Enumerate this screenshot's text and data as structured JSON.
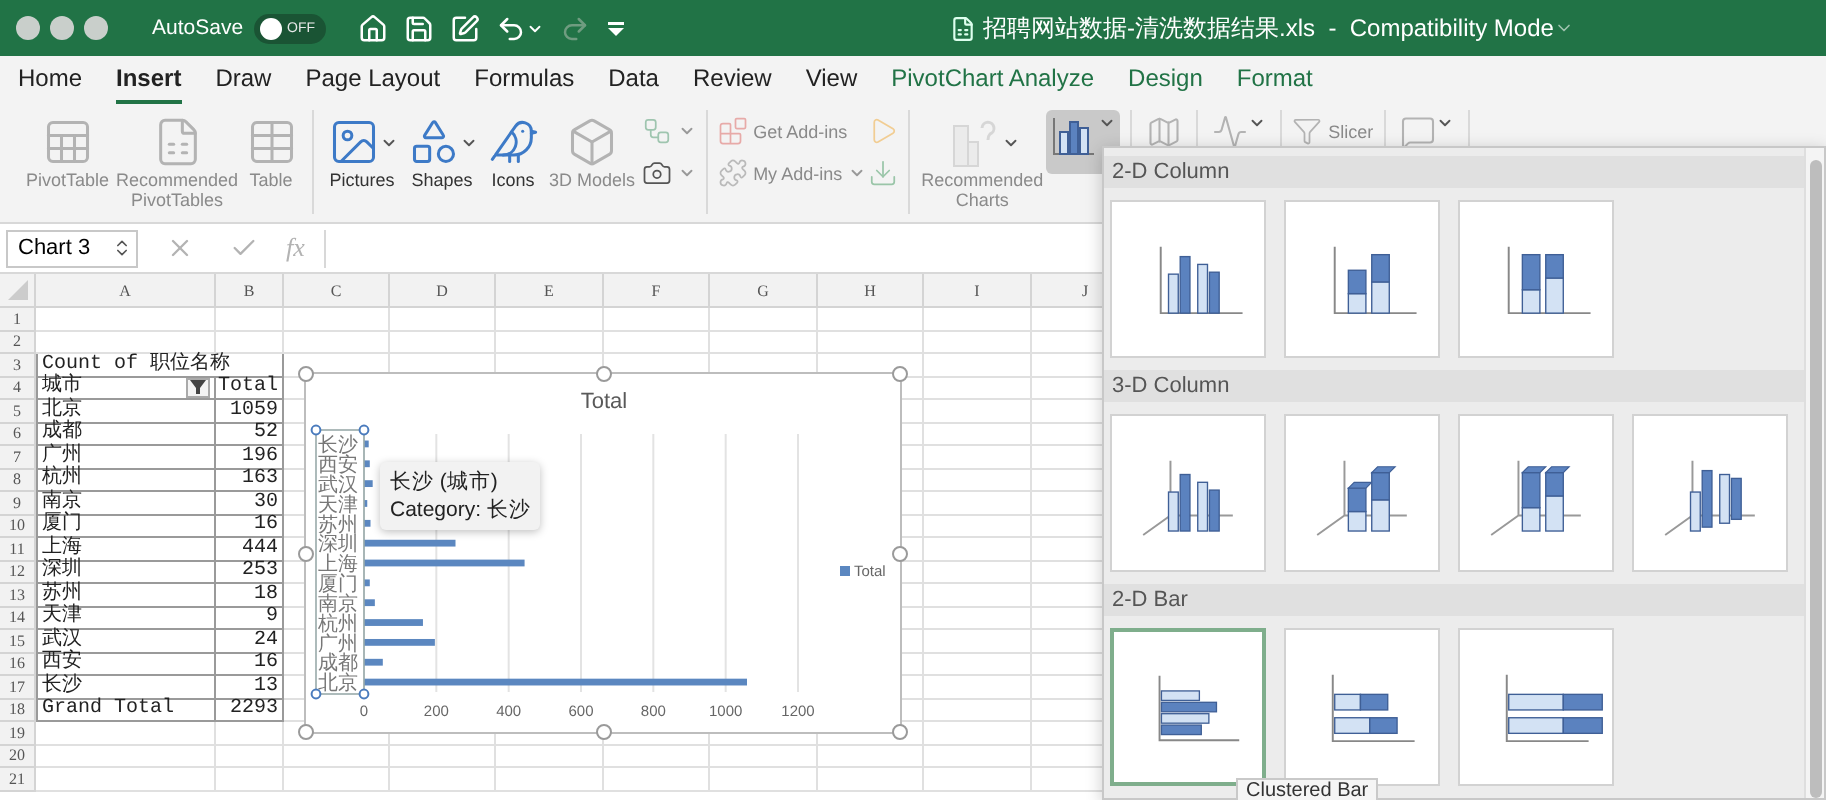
{
  "window": {
    "title": "招聘网站数据-清洗数据结果.xls  -  Compatibility Mode",
    "autosave": {
      "label": "AutoSave",
      "on": false,
      "state_text": "OFF"
    }
  },
  "quick_access": [
    {
      "disabled": false
    },
    {
      "disabled": false
    },
    {
      "disabled": false
    },
    {
      "disabled": false
    },
    {
      "disabled": true
    },
    {
      "disabled": false
    }
  ],
  "tabs": [
    {
      "label": "Home",
      "kind": "standard",
      "selected": false
    },
    {
      "label": "Insert",
      "kind": "standard",
      "selected": true
    },
    {
      "label": "Draw",
      "kind": "standard",
      "selected": false
    },
    {
      "label": "Page Layout",
      "kind": "standard",
      "selected": false
    },
    {
      "label": "Formulas",
      "kind": "standard",
      "selected": false
    },
    {
      "label": "Data",
      "kind": "standard",
      "selected": false
    },
    {
      "label": "Review",
      "kind": "standard",
      "selected": false
    },
    {
      "label": "View",
      "kind": "standard",
      "selected": false
    },
    {
      "label": "PivotChart Analyze",
      "kind": "contextual",
      "selected": false
    },
    {
      "label": "Design",
      "kind": "contextual",
      "selected": false
    },
    {
      "label": "Format",
      "kind": "contextual",
      "selected": false
    }
  ],
  "ribbon": {
    "groups": [
      {
        "items": [
          {
            "kind": "large",
            "label": "PivotTable",
            "disabled": true,
            "menu": false,
            "pressed": false
          },
          {
            "kind": "large",
            "label": "Recommended PivotTables",
            "disabled": true,
            "menu": false,
            "pressed": false
          },
          {
            "kind": "large",
            "label": "Table",
            "disabled": true,
            "menu": false,
            "pressed": false
          }
        ]
      },
      {
        "items": [
          {
            "kind": "large",
            "label": "Pictures",
            "disabled": false,
            "menu": true,
            "pressed": false
          },
          {
            "kind": "large",
            "label": "Shapes",
            "disabled": false,
            "menu": true,
            "pressed": false
          },
          {
            "kind": "large",
            "label": "Icons",
            "disabled": false,
            "menu": false,
            "pressed": false
          },
          {
            "kind": "large",
            "label": "3D Models",
            "disabled": true,
            "menu": false,
            "pressed": false
          },
          {
            "kind": "icon",
            "disabled": true,
            "menu": true,
            "pressed": false
          },
          {
            "kind": "icon",
            "disabled": false,
            "menu": true,
            "pressed": false
          }
        ]
      },
      {
        "items": [
          {
            "kind": "small",
            "label": "Get Add-ins",
            "disabled": true,
            "menu": false,
            "pressed": false
          },
          {
            "kind": "small",
            "label": "My Add-ins",
            "disabled": true,
            "menu": true,
            "pressed": false
          },
          {
            "kind": "icon",
            "disabled": true,
            "menu": false,
            "pressed": false
          },
          {
            "kind": "icon",
            "disabled": true,
            "menu": false,
            "pressed": false
          }
        ]
      },
      {
        "items": [
          {
            "kind": "large",
            "label": "Recommended Charts",
            "disabled": true,
            "menu": true,
            "pressed": false
          },
          {
            "kind": "large",
            "disabled": false,
            "menu": true,
            "pressed": true
          }
        ]
      },
      {
        "items": [
          {
            "kind": "large",
            "disabled": true,
            "menu": false,
            "pressed": false
          }
        ]
      },
      {
        "items": [
          {
            "kind": "large",
            "disabled": true,
            "menu": true,
            "pressed": false
          }
        ]
      },
      {
        "items": [
          {
            "kind": "small",
            "label": "Slicer",
            "disabled": true,
            "menu": false,
            "pressed": false
          }
        ]
      },
      {
        "items": [
          {
            "kind": "large",
            "disabled": true,
            "menu": true,
            "pressed": false
          }
        ]
      }
    ]
  },
  "formula_bar": {
    "name_box": "Chart 3",
    "function_label": "fx"
  },
  "sheet": {
    "columns": [
      "A",
      "B",
      "C",
      "D",
      "E",
      "F",
      "G",
      "H",
      "I",
      "J"
    ],
    "row_numbers": [
      "1",
      "2",
      "3",
      "4",
      "5",
      "6",
      "7",
      "8",
      "9",
      "10",
      "11",
      "12",
      "13",
      "14",
      "15",
      "16",
      "17",
      "18",
      "19",
      "20",
      "21"
    ],
    "pivot": {
      "header": "Count of 职位名称",
      "row_label": "城市",
      "value_label": "Total",
      "rows": [
        {
          "city": "北京",
          "count": "1059"
        },
        {
          "city": "成都",
          "count": "52"
        },
        {
          "city": "广州",
          "count": "196"
        },
        {
          "city": "杭州",
          "count": "163"
        },
        {
          "city": "南京",
          "count": "30"
        },
        {
          "city": "厦门",
          "count": "16"
        },
        {
          "city": "上海",
          "count": "444"
        },
        {
          "city": "深圳",
          "count": "253"
        },
        {
          "city": "苏州",
          "count": "18"
        },
        {
          "city": "天津",
          "count": "9"
        },
        {
          "city": "武汉",
          "count": "24"
        },
        {
          "city": "西安",
          "count": "16"
        },
        {
          "city": "长沙",
          "count": "13"
        }
      ],
      "total_label": "Grand Total",
      "total": "2293"
    },
    "chart": {
      "tooltip": {
        "title": "长沙 (城市)",
        "text": "Category: 长沙"
      },
      "chart_data": {
        "type": "bar",
        "orientation": "horizontal",
        "title": "Total",
        "categories": [
          "长沙",
          "西安",
          "武汉",
          "天津",
          "苏州",
          "深圳",
          "上海",
          "厦门",
          "南京",
          "杭州",
          "广州",
          "成都",
          "北京"
        ],
        "series": [
          {
            "name": "Total",
            "color": "#5b87c0",
            "values": [
              13,
              16,
              24,
              9,
              18,
              253,
              444,
              16,
              30,
              163,
              196,
              52,
              1059
            ]
          }
        ],
        "xlim": [
          0,
          1200
        ],
        "xticks": [
          0,
          200,
          400,
          600,
          800,
          1000,
          1200
        ],
        "grid": true
      }
    }
  },
  "chart_gallery": {
    "sections": [
      {
        "title": "2-D Column",
        "options": [
          {
            "kind": "clustered-column",
            "selected": false
          },
          {
            "kind": "stacked-column",
            "selected": false
          },
          {
            "kind": "full-stacked-column",
            "selected": false
          }
        ]
      },
      {
        "title": "3-D Column",
        "options": [
          {
            "kind": "clustered-column-3d",
            "selected": false
          },
          {
            "kind": "stacked-column-3d",
            "selected": false
          },
          {
            "kind": "full-stacked-column-3d",
            "selected": false
          },
          {
            "kind": "column-3d",
            "selected": false
          }
        ]
      },
      {
        "title": "2-D Bar",
        "options": [
          {
            "kind": "clustered-bar",
            "selected": true
          },
          {
            "kind": "stacked-bar",
            "selected": false
          },
          {
            "kind": "full-stacked-bar",
            "selected": false
          }
        ]
      }
    ],
    "tooltip": "Clustered Bar"
  }
}
